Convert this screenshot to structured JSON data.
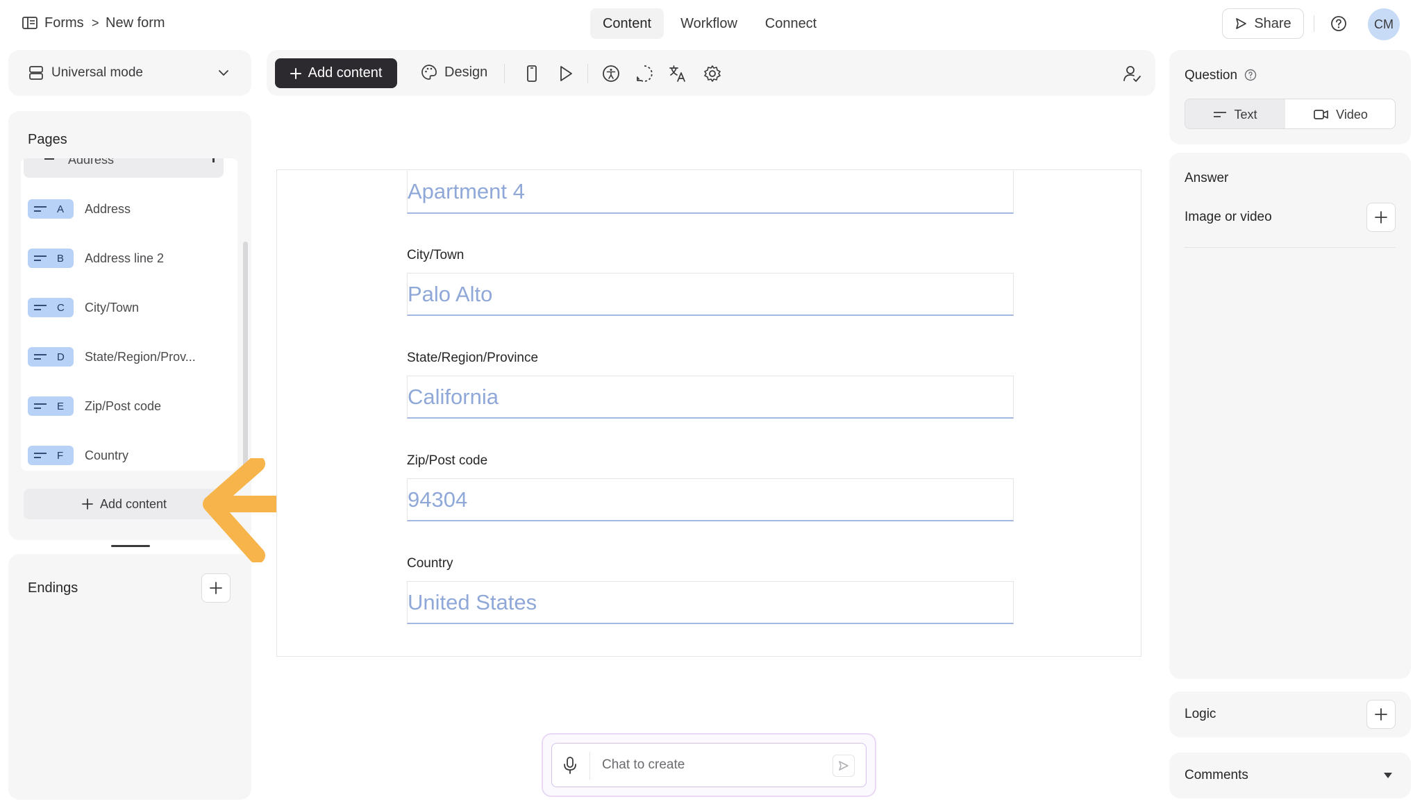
{
  "breadcrumb": {
    "root": "Forms",
    "separator": ">",
    "current": "New form"
  },
  "top_tabs": [
    {
      "label": "Content",
      "active": true
    },
    {
      "label": "Workflow",
      "active": false
    },
    {
      "label": "Connect",
      "active": false
    }
  ],
  "share_label": "Share",
  "avatar_initials": "CM",
  "mode_selector": {
    "label": "Universal mode"
  },
  "toolbar": {
    "add_content": "Add content",
    "design": "Design"
  },
  "pages_panel": {
    "title": "Pages",
    "partial_item": "Address",
    "items": [
      {
        "letter": "A",
        "label": "Address"
      },
      {
        "letter": "B",
        "label": "Address line 2"
      },
      {
        "letter": "C",
        "label": "City/Town"
      },
      {
        "letter": "D",
        "label": "State/Region/Prov..."
      },
      {
        "letter": "E",
        "label": "Zip/Post code"
      },
      {
        "letter": "F",
        "label": "Country"
      }
    ],
    "add_content": "Add content"
  },
  "endings": {
    "title": "Endings"
  },
  "form": {
    "fields": [
      {
        "label": "",
        "value": "Apartment 4"
      },
      {
        "label": "City/Town",
        "value": "Palo Alto"
      },
      {
        "label": "State/Region/Province",
        "value": "California"
      },
      {
        "label": "Zip/Post code",
        "value": "94304"
      },
      {
        "label": "Country",
        "value": "United States"
      }
    ]
  },
  "chat": {
    "placeholder": "Chat to create"
  },
  "right_panel": {
    "question_title": "Question",
    "question_tabs": [
      {
        "label": "Text",
        "active": true
      },
      {
        "label": "Video",
        "active": false
      }
    ],
    "answer_title": "Answer",
    "image_or_video": "Image or video",
    "logic": "Logic",
    "comments": "Comments"
  },
  "colors": {
    "accent_badge": "#b8d1f6",
    "arrow": "#f7b44a",
    "primary_button": "#2c2a2f",
    "input_text": "#8fa8d8"
  }
}
